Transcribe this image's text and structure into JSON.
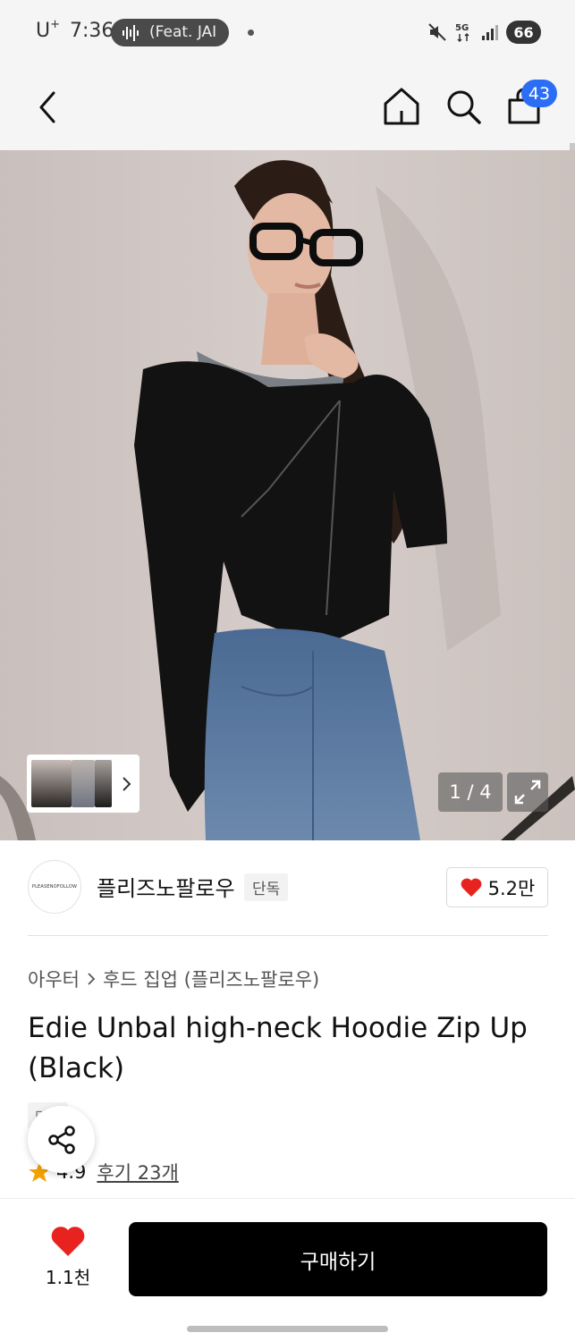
{
  "status_bar": {
    "carrier": "U",
    "carrier_sup": "+",
    "time": "7:36",
    "media_text": "(Feat. JAI",
    "battery": "66",
    "icons": [
      "mute-icon",
      "5g-icon",
      "signal-icon",
      "battery-icon"
    ]
  },
  "nav": {
    "cart_count": "43",
    "icons": [
      "back-chevron-icon",
      "home-icon",
      "search-icon",
      "shopping-bag-icon"
    ]
  },
  "gallery": {
    "counter": "1 / 4",
    "thumbnails": [
      "thumb-1",
      "thumb-2",
      "thumb-3"
    ]
  },
  "brand": {
    "logo_text": "PLEASENOFOLLOW",
    "name": "플리즈노팔로우",
    "tag": "단독",
    "like_count": "5.2만"
  },
  "product": {
    "breadcrumb": [
      "아우터",
      "후드 집업 (플리즈노팔로우)"
    ],
    "title": "Edie Unbal high-neck Hoodie Zip Up (Black)",
    "exclusive_tag": "단독",
    "rating": "4.9",
    "reviews": "후기 23개"
  },
  "bottom_bar": {
    "wish_count": "1.1천",
    "buy_label": "구매하기"
  },
  "colors": {
    "accent_blue": "#2b6ef5",
    "heart_red": "#e8231f",
    "star_orange": "#f5a100",
    "buy_black": "#000000"
  }
}
